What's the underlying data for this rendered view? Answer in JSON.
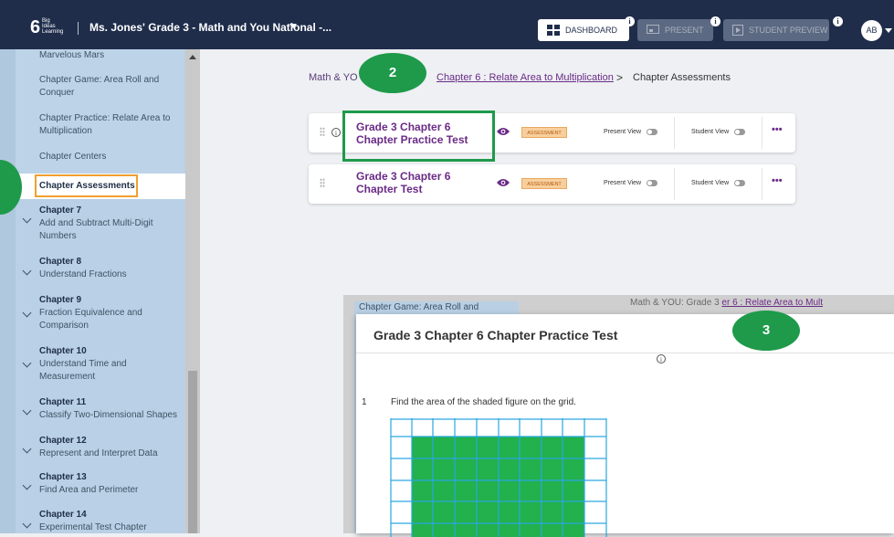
{
  "topbar": {
    "logo_text": "Big Ideas Learning",
    "logo_mark": "6",
    "course_title": "Ms. Jones' Grade 3 - Math and You National -...",
    "dashboard_label": "DASHBOARD",
    "present_label": "PRESENT",
    "student_preview_label": "STUDENT PREVIEW",
    "info_glyph": "i",
    "avatar_initials": "AB"
  },
  "sidebar": {
    "top_items": [
      "Marvelous Mars",
      "Chapter Game: Area Roll and Conquer",
      "Chapter Practice: Relate Area to Multiplication",
      "Chapter Centers"
    ],
    "active_item": "Chapter Assessments",
    "chapters": [
      {
        "title": "Chapter 7",
        "subtitle": "Add and Subtract Multi-Digit Numbers"
      },
      {
        "title": "Chapter 8",
        "subtitle": "Understand Fractions"
      },
      {
        "title": "Chapter 9",
        "subtitle": "Fraction Equivalence and Comparison"
      },
      {
        "title": "Chapter 10",
        "subtitle": "Understand Time and Measurement"
      },
      {
        "title": "Chapter 11",
        "subtitle": "Classify Two-Dimensional Shapes"
      },
      {
        "title": "Chapter 12",
        "subtitle": "Represent and Interpret Data"
      },
      {
        "title": "Chapter 13",
        "subtitle": "Find Area and Perimeter"
      },
      {
        "title": "Chapter 14",
        "subtitle": "Experimental Test Chapter"
      }
    ]
  },
  "breadcrumb": {
    "root": "Math & YO",
    "chapter_link": "Chapter 6 : Relate Area to Multiplication",
    "separator": ">",
    "current": "Chapter Assessments"
  },
  "callouts": {
    "two": "2",
    "three": "3"
  },
  "cards": [
    {
      "title": "Grade 3 Chapter 6 Chapter Practice Test",
      "tag": "ASSESSMENT",
      "present_view": "Present View",
      "student_view": "Student View",
      "more": "•••"
    },
    {
      "title": "Grade 3 Chapter 6 Chapter Test",
      "tag": "ASSESSMENT",
      "present_view": "Present View",
      "student_view": "Student View",
      "more": "•••"
    }
  ],
  "preview_backdrop": {
    "sidebar_text": "Chapter Game: Area Roll and",
    "breadcrumb_text": "Math & YOU: Grade 3",
    "breadcrumb_link": "er 6 : Relate Area to Mult"
  },
  "modal": {
    "title": "Grade 3 Chapter 6 Chapter Practice Test",
    "info_glyph": "i",
    "question_number": "1",
    "question_text": "Find the area of the shaded figure on the grid."
  },
  "colors": {
    "topbar": "#1f2d4b",
    "sidebar": "#b9d0e6",
    "accent_purple": "#6a2b86",
    "callout_green": "#1e9a4a",
    "active_outline": "#f0a030",
    "grid_line": "#2aa7e0",
    "grid_fill": "#22b14c"
  }
}
